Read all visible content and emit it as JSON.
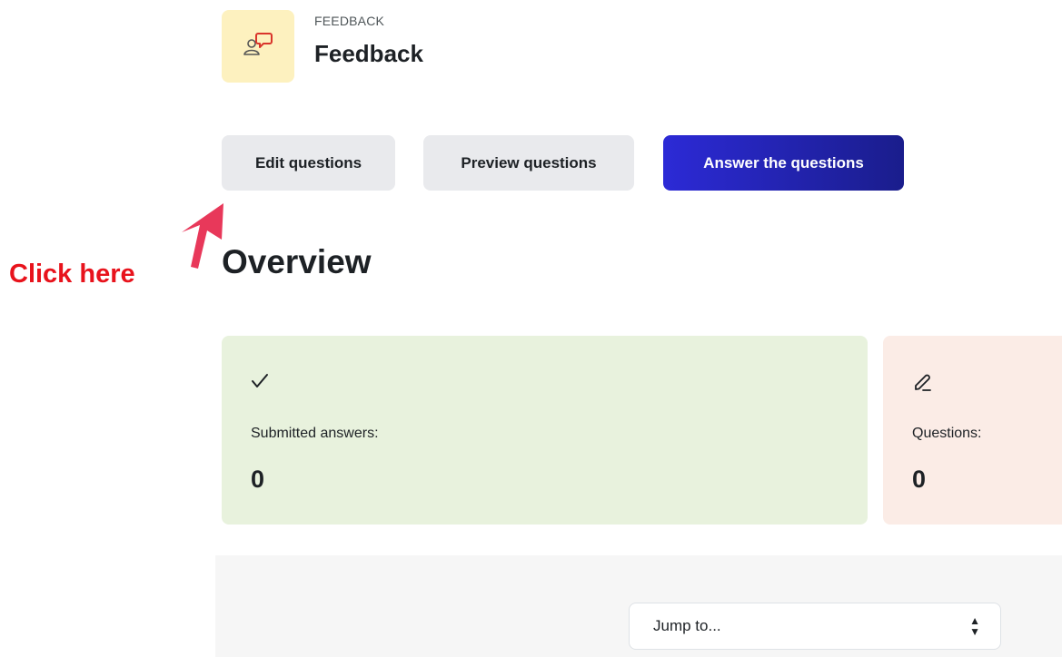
{
  "header": {
    "pretitle": "FEEDBACK",
    "title": "Feedback",
    "icon": "feedback-speech-bubble-icon"
  },
  "tabs": {
    "edit": "Edit questions",
    "preview": "Preview questions",
    "answer": "Answer the questions"
  },
  "annotation": {
    "text": "Click here",
    "color": "#e8131c",
    "arrow_icon": "arrow-icon"
  },
  "overview": {
    "heading": "Overview",
    "cards": [
      {
        "icon": "check-icon",
        "label": "Submitted answers:",
        "value": "0",
        "color": "#e8f2dd"
      },
      {
        "icon": "pencil-icon",
        "label": "Questions:",
        "value": "0",
        "color": "#fbece6"
      }
    ]
  },
  "footer": {
    "jump_select": "Jump to..."
  },
  "colors": {
    "primary": "#2c2ad6",
    "secondary_button": "#e9eaed",
    "icon_background": "#fdf1bf"
  }
}
